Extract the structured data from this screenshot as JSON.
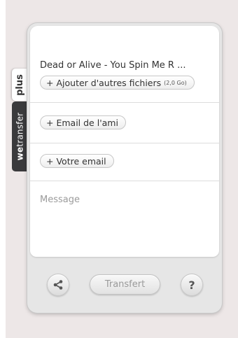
{
  "side_tabs": {
    "plus_label": "plus",
    "wetransfer_brand_bold": "we",
    "wetransfer_brand_rest": "transfer"
  },
  "upload": {
    "file_name": "Dead or Alive - You Spin Me R ...",
    "add_files_label": "Ajouter d'autres fichiers",
    "add_files_limit": "(2,0 Go)",
    "friend_email_label": "Email de l'ami",
    "your_email_label": "Votre email",
    "message_placeholder": "Message"
  },
  "toolbar": {
    "transfer_label": "Transfert",
    "help_label": "?",
    "share_icon": "share-icon"
  },
  "icons": {
    "plus_prefix": "+"
  },
  "colors": {
    "backdrop": "#ede7e7",
    "brand_tab": "#3a3a3c",
    "placeholder_text": "#9b9b9b"
  }
}
